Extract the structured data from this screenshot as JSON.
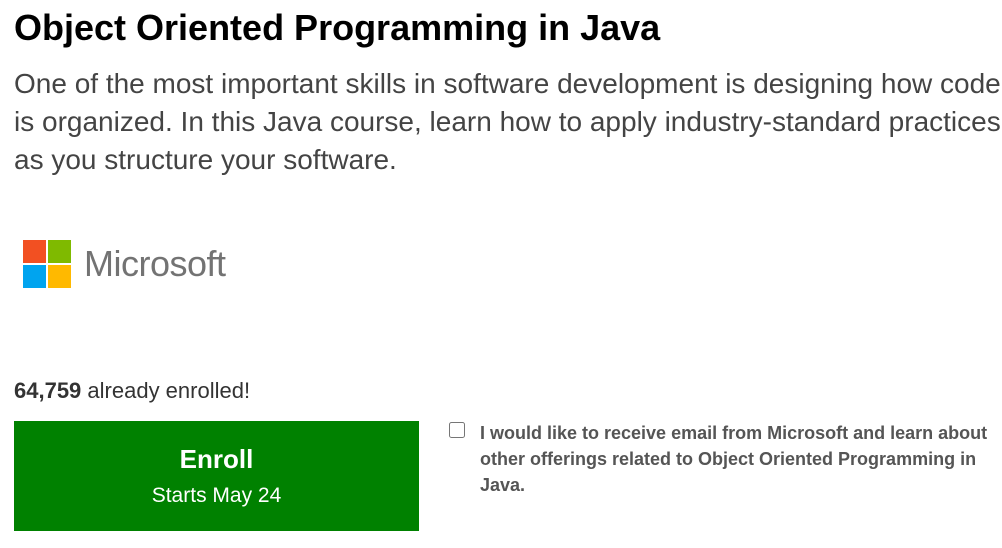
{
  "course": {
    "title": "Object Oriented Programming in Java",
    "description": "One of the most important skills in software development is designing how code is organized. In this Java course, learn how to apply industry-standard practices as you structure your software."
  },
  "provider": {
    "name": "Microsoft",
    "logo_icon": "microsoft-logo-icon",
    "logo_colors": [
      "#F25022",
      "#7FBA00",
      "#00A4EF",
      "#FFB900"
    ]
  },
  "enrollment": {
    "count": "64,759",
    "suffix": " already enrolled!"
  },
  "enroll_button": {
    "label": "Enroll",
    "subtext": "Starts May 24",
    "color": "#008100"
  },
  "optin": {
    "checked": false,
    "label": "I would like to receive email from Microsoft and learn about other offerings related to Object Oriented Programming in Java."
  }
}
